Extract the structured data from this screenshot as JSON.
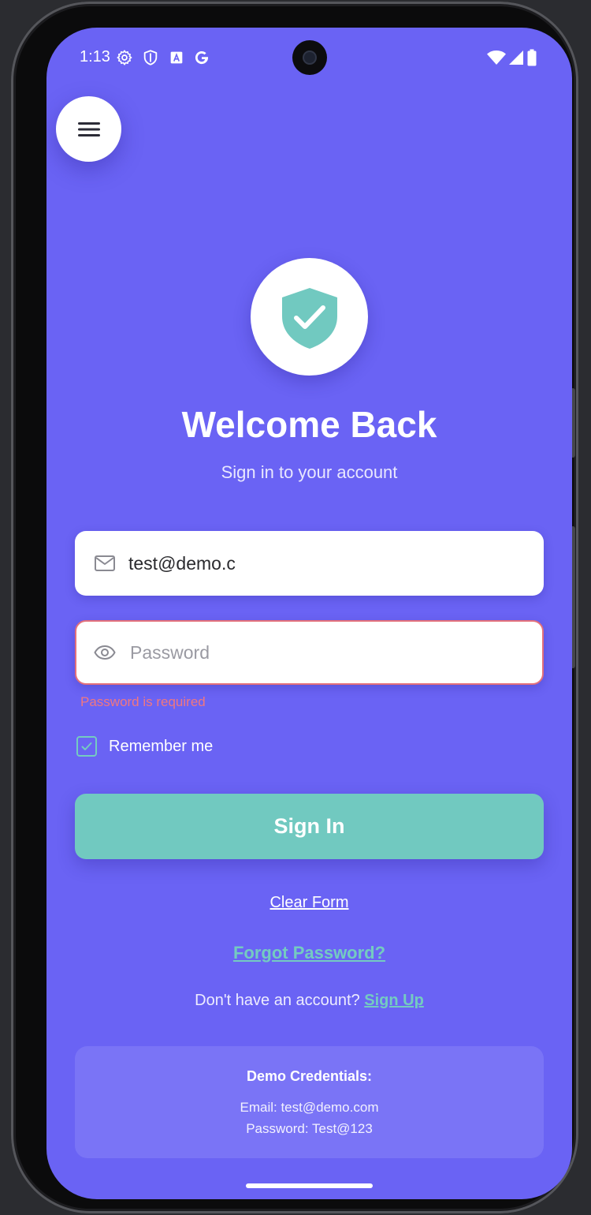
{
  "status_bar": {
    "time": "1:13",
    "left_icons": [
      "settings-icon",
      "shield-icon",
      "font-icon",
      "google-icon"
    ],
    "right_icons": [
      "wifi-icon",
      "signal-icon",
      "battery-icon"
    ]
  },
  "menu": {
    "icon": "hamburger-menu-icon"
  },
  "logo": {
    "icon": "shield-check-icon"
  },
  "header": {
    "title": "Welcome Back",
    "subtitle": "Sign in to your account"
  },
  "form": {
    "email": {
      "icon": "mail-icon",
      "value": "test@demo.c"
    },
    "password": {
      "icon": "eye-icon",
      "value": "",
      "placeholder": "Password",
      "error": "Password is required"
    },
    "remember_me": {
      "label": "Remember me",
      "checked": true
    },
    "submit_label": "Sign In"
  },
  "links": {
    "clear_form": "Clear Form",
    "forgot_password": "Forgot Password?",
    "signup_prompt": "Don't have an account?",
    "signup": "Sign Up"
  },
  "demo": {
    "title": "Demo Credentials:",
    "email_line": "Email: test@demo.com",
    "password_line": "Password: Test@123"
  },
  "colors": {
    "background": "#6a63f4",
    "accent": "#71c9c0",
    "error": "#f07780",
    "surface": "#ffffff"
  }
}
